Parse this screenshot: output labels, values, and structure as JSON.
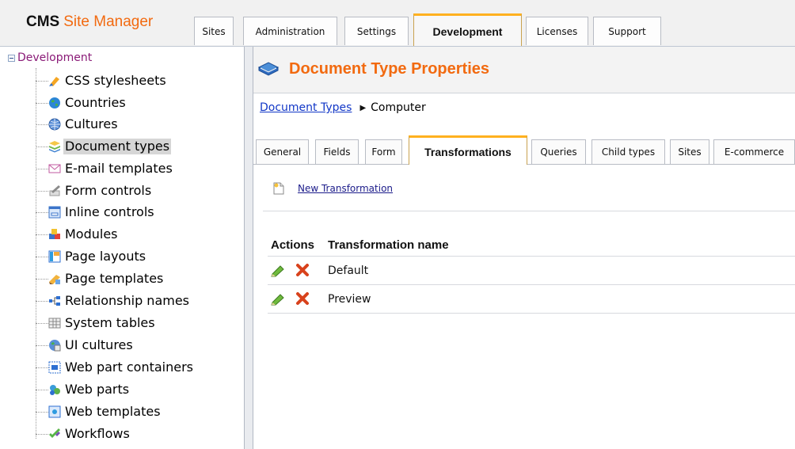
{
  "app": {
    "logo_bold": "CMS",
    "logo_text": "Site Manager"
  },
  "main_tabs": [
    {
      "label": "Sites"
    },
    {
      "label": "Administration"
    },
    {
      "label": "Settings"
    },
    {
      "label": "Development",
      "active": true
    },
    {
      "label": "Licenses"
    },
    {
      "label": "Support"
    }
  ],
  "sidebar": {
    "root_label": "Development",
    "items": [
      {
        "label": "CSS stylesheets",
        "icon": "css-stylesheets-icon"
      },
      {
        "label": "Countries",
        "icon": "globe-icon"
      },
      {
        "label": "Cultures",
        "icon": "world-icon"
      },
      {
        "label": "Document types",
        "icon": "document-types-icon",
        "selected": true
      },
      {
        "label": "E-mail templates",
        "icon": "email-icon"
      },
      {
        "label": "Form controls",
        "icon": "form-controls-icon"
      },
      {
        "label": "Inline controls",
        "icon": "inline-controls-icon"
      },
      {
        "label": "Modules",
        "icon": "modules-icon"
      },
      {
        "label": "Page layouts",
        "icon": "page-layouts-icon"
      },
      {
        "label": "Page templates",
        "icon": "page-templates-icon"
      },
      {
        "label": "Relationship names",
        "icon": "relationship-icon"
      },
      {
        "label": "System tables",
        "icon": "table-icon"
      },
      {
        "label": "UI cultures",
        "icon": "ui-cultures-icon"
      },
      {
        "label": "Web part containers",
        "icon": "web-part-containers-icon"
      },
      {
        "label": "Web parts",
        "icon": "web-parts-icon"
      },
      {
        "label": "Web templates",
        "icon": "web-templates-icon"
      },
      {
        "label": "Workflows",
        "icon": "workflows-icon"
      }
    ]
  },
  "content": {
    "title": "Document Type Properties",
    "breadcrumb": {
      "link": "Document Types",
      "separator": "▶",
      "current": "Computer"
    },
    "tabs": [
      {
        "label": "General"
      },
      {
        "label": "Fields"
      },
      {
        "label": "Form"
      },
      {
        "label": "Transformations",
        "active": true
      },
      {
        "label": "Queries"
      },
      {
        "label": "Child types"
      },
      {
        "label": "Sites"
      },
      {
        "label": "E-commerce"
      }
    ],
    "new_action": "New Transformation",
    "grid": {
      "columns": [
        "Actions",
        "Transformation name"
      ],
      "rows": [
        {
          "name": "Default"
        },
        {
          "name": "Preview"
        }
      ]
    }
  },
  "colors": {
    "accent_orange": "#f26a10",
    "tab_highlight": "#ffb11f",
    "link_blue": "#1237c7",
    "tree_root": "#8a1a77"
  }
}
